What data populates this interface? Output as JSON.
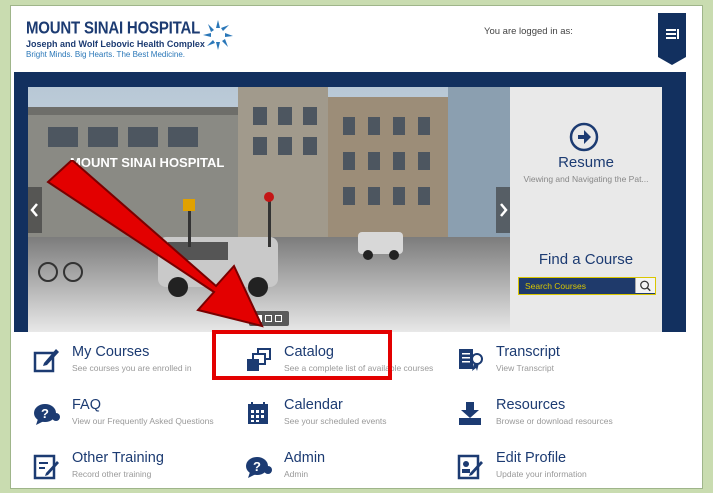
{
  "header": {
    "logo_title": "MOUNT SINAI HOSPITAL",
    "logo_subtitle": "Joseph and Wolf Lebovic Health Complex",
    "logo_tagline": "Bright Minds. Big Hearts. The Best Medicine.",
    "login_text": "You are logged in as:",
    "menu_icon": "menu-icon"
  },
  "hero": {
    "building_sign": "MOUNT SINAI HOSPITAL",
    "slide_indicator": {
      "count": 3,
      "active": 0
    }
  },
  "side_panel": {
    "resume_title": "Resume",
    "resume_subtitle": "Viewing and Navigating the Pat...",
    "find_title": "Find a Course",
    "search_placeholder": "Search Courses"
  },
  "tiles": [
    {
      "title": "My Courses",
      "subtitle": "See courses you are enrolled in",
      "icon": "pencil-box-icon"
    },
    {
      "title": "Catalog",
      "subtitle": "See a complete list of available courses",
      "icon": "catalog-icon"
    },
    {
      "title": "Transcript",
      "subtitle": "View Transcript",
      "icon": "transcript-icon"
    },
    {
      "title": "FAQ",
      "subtitle": "View our Frequently Asked Questions",
      "icon": "question-bubble-icon"
    },
    {
      "title": "Calendar",
      "subtitle": "See your scheduled events",
      "icon": "calendar-icon"
    },
    {
      "title": "Resources",
      "subtitle": "Browse or download resources",
      "icon": "download-icon"
    },
    {
      "title": "Other Training",
      "subtitle": "Record other training",
      "icon": "edit-note-icon"
    },
    {
      "title": "Admin",
      "subtitle": "Admin",
      "icon": "question-bubble-icon"
    },
    {
      "title": "Edit Profile",
      "subtitle": "Update your information",
      "icon": "edit-profile-icon"
    }
  ],
  "colors": {
    "navy": "#12305f",
    "title_blue": "#1c3b72",
    "highlight_red": "#e30000",
    "search_yellow": "#d9c600",
    "page_bg": "#c9dcb0"
  }
}
